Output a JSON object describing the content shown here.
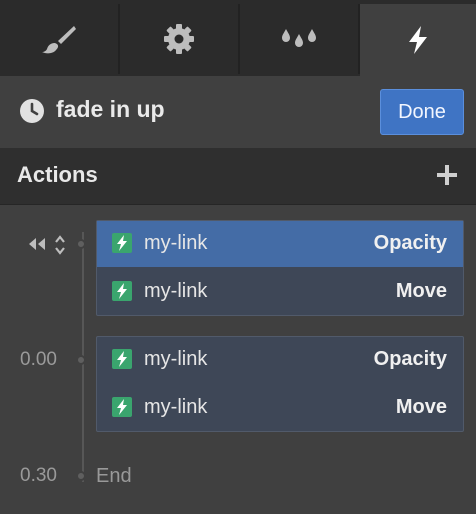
{
  "tabs": [
    {
      "name": "brush-icon"
    },
    {
      "name": "gear-icon"
    },
    {
      "name": "drops-icon"
    },
    {
      "name": "lightning-icon"
    }
  ],
  "header": {
    "title": "fade in up",
    "done_label": "Done"
  },
  "actions": {
    "title": "Actions"
  },
  "timeline": {
    "groups": [
      {
        "time": "",
        "rows": [
          {
            "target": "my-link",
            "property": "Opacity",
            "selected": true
          },
          {
            "target": "my-link",
            "property": "Move",
            "selected": false
          }
        ]
      },
      {
        "time": "0.00",
        "rows": [
          {
            "target": "my-link",
            "property": "Opacity",
            "selected": false
          },
          {
            "target": "my-link",
            "property": "Move",
            "selected": false
          }
        ]
      }
    ],
    "end_time": "0.30",
    "end_label": "End"
  },
  "colors": {
    "accent": "#3f74c4",
    "selected_row": "#446ca6",
    "bolt_badge": "#3aa56e"
  }
}
